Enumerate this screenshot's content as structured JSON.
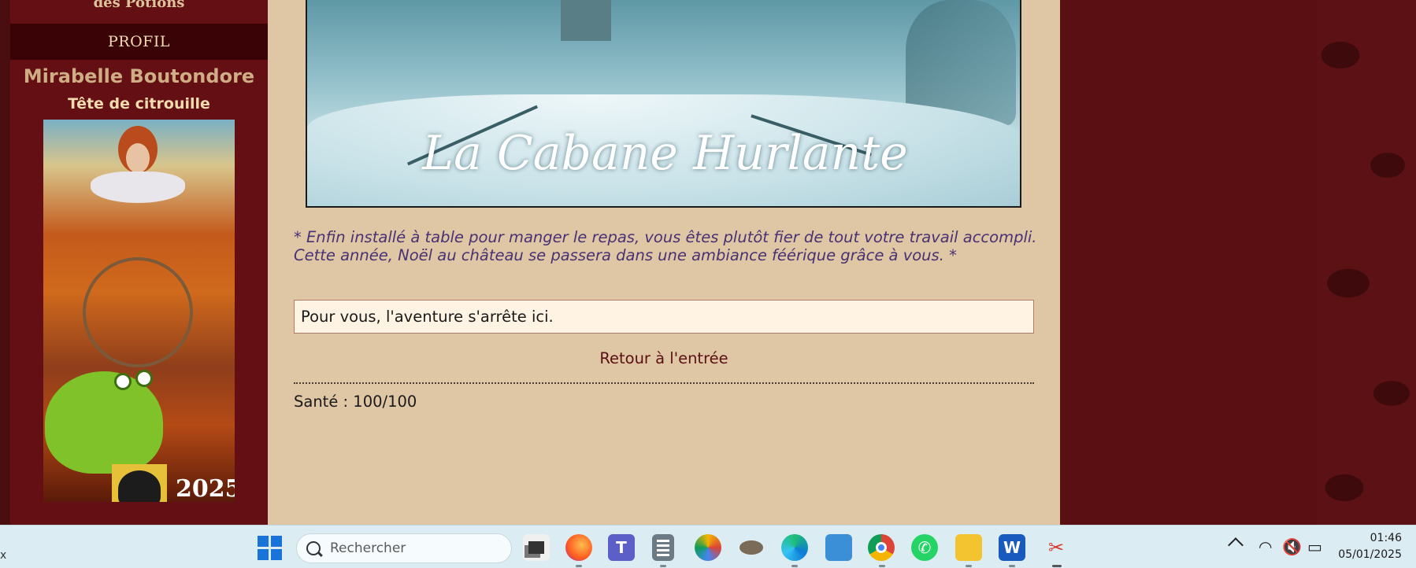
{
  "sidebar": {
    "cut_text": "des Potions",
    "profile_header": "PROFIL",
    "character_name": "Mirabelle Boutondore",
    "character_title": "Tête de citrouille",
    "portrait_year": "2025"
  },
  "main": {
    "banner_title": "La Cabane Hurlante",
    "narration": "* Enfin installé à table pour manger le repas, vous êtes plutôt fier de tout votre travail accompli. Cette année, Noël au château se passera dans une ambiance féérique grâce à vous. *",
    "end_message": "Pour vous, l'aventure s'arrête ici.",
    "return_link": "Retour à l'entrée",
    "health_label": "Santé : 100/100"
  },
  "taskbar": {
    "left_label": "x",
    "search_placeholder": "Rechercher",
    "apps": [
      "task-view",
      "firefox",
      "teams",
      "calculator",
      "paint",
      "gimp",
      "edge",
      "control-panel",
      "chrome",
      "whatsapp",
      "file-explorer",
      "word",
      "snipping-tool"
    ],
    "time": "01:46",
    "date": "05/01/2025"
  },
  "colors": {
    "sidebar_bg": "#630f14",
    "main_bg": "#dfc6a4",
    "narration_text": "#483274",
    "link_color": "#5a1012"
  }
}
